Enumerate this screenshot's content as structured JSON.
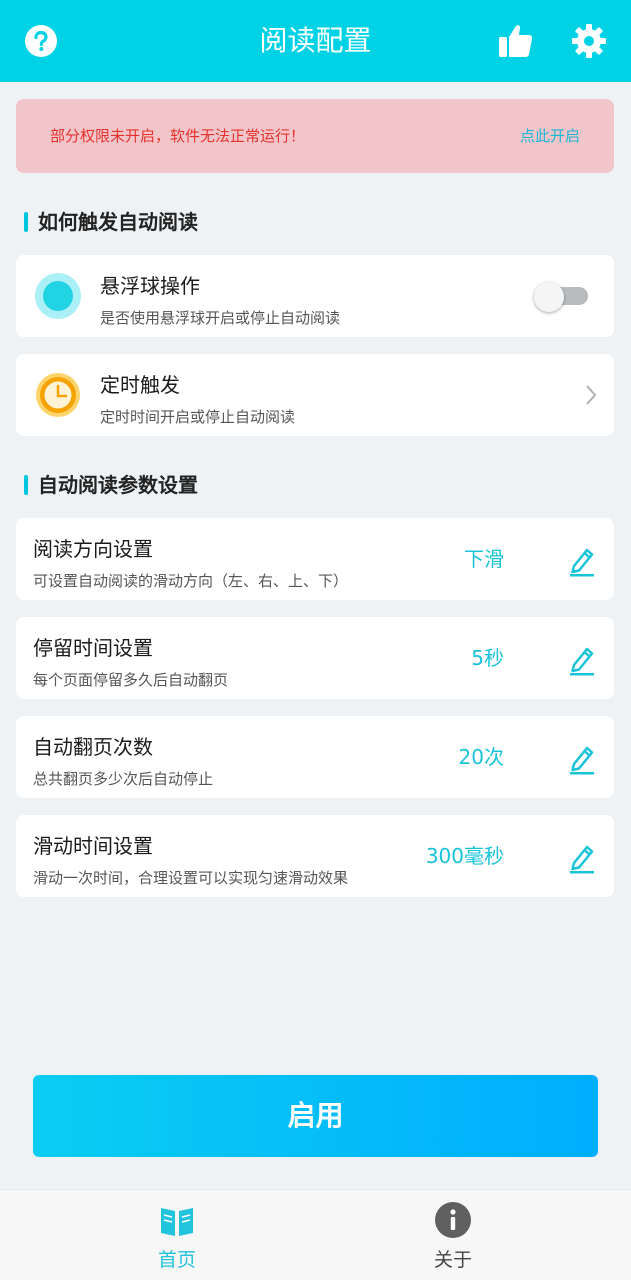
{
  "header": {
    "title": "阅读配置",
    "icons": [
      "help-icon",
      "thumbs-up-icon",
      "gear-icon"
    ]
  },
  "alert": {
    "message": "部分权限未开启，软件无法正常运行！",
    "action": "点此开启"
  },
  "trigger_section": {
    "title": "如何触发自动阅读",
    "items": [
      {
        "title": "悬浮球操作",
        "subtitle": "是否使用悬浮球开启或停止自动阅读",
        "toggle": false
      },
      {
        "title": "定时触发",
        "subtitle": "定时时间开启或停止自动阅读"
      }
    ]
  },
  "params_section": {
    "title": "自动阅读参数设置",
    "items": [
      {
        "title": "阅读方向设置",
        "subtitle": "可设置自动阅读的滑动方向（左、右、上、下）",
        "value": "下滑"
      },
      {
        "title": "停留时间设置",
        "subtitle": "每个页面停留多久后自动翻页",
        "value": "5秒"
      },
      {
        "title": "自动翻页次数",
        "subtitle": "总共翻页多少次后自动停止",
        "value": "20次"
      },
      {
        "title": "滑动时间设置",
        "subtitle": "滑动一次时间，合理设置可以实现匀速滑动效果",
        "value": "300毫秒"
      }
    ]
  },
  "enable_button": "启用",
  "bottom_nav": {
    "items": [
      {
        "label": "首页",
        "icon": "book-icon",
        "active": true
      },
      {
        "label": "关于",
        "icon": "info-icon",
        "active": false
      }
    ]
  },
  "colors": {
    "accent": "#00d2e6",
    "value_text": "#19c4d8",
    "alert_bg": "#f2c5cb",
    "alert_text": "#e5322c"
  }
}
